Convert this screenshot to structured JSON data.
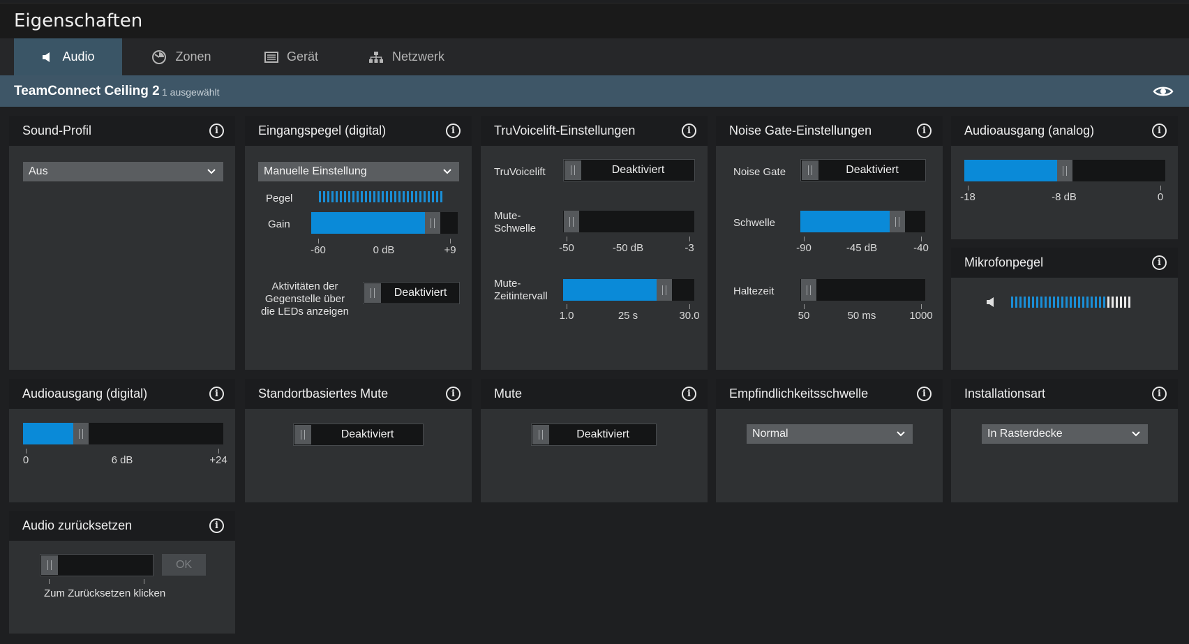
{
  "window": {
    "title": "Eigenschaften"
  },
  "tabs": [
    {
      "label": "Audio",
      "icon": "speaker-icon",
      "active": true
    },
    {
      "label": "Zonen",
      "icon": "zones-icon",
      "active": false
    },
    {
      "label": "Gerät",
      "icon": "device-icon",
      "active": false
    },
    {
      "label": "Netzwerk",
      "icon": "network-icon",
      "active": false
    }
  ],
  "device": {
    "name": "TeamConnect Ceiling 2",
    "selected": "1 ausgewählt"
  },
  "colors": {
    "accent": "#0a8ad8",
    "panel": "#2f3133",
    "header": "#1b1c1e",
    "tab_active": "#3a5566"
  },
  "sound_profile": {
    "title": "Sound-Profil",
    "value": "Aus"
  },
  "input_level": {
    "title": "Eingangspegel (digital)",
    "mode": "Manuelle Einstellung",
    "level_label": "Pegel",
    "gain_label": "Gain",
    "gain": {
      "min": "-60",
      "value": "0 dB",
      "max": "+9",
      "fraction": 0.87
    },
    "led_label": [
      "Aktivitäten der",
      "Gegenstelle über",
      "die LEDs anzeigen"
    ],
    "led_state": "Deaktiviert"
  },
  "truvoicelift": {
    "title": "TruVoicelift-Einstellungen",
    "enable_label": "TruVoicelift",
    "enable_state": "Deaktiviert",
    "threshold_label": [
      "Mute-",
      "Schwelle"
    ],
    "threshold": {
      "min": "-50",
      "value": "-50 dB",
      "max": "-3",
      "fraction": 0.0
    },
    "interval_label": [
      "Mute-",
      "Zeitintervall"
    ],
    "interval": {
      "min": "1.0",
      "value": "25 s",
      "max": "30.0",
      "fraction": 0.81
    }
  },
  "noise_gate": {
    "title": "Noise Gate-Einstellungen",
    "enable_label": "Noise Gate",
    "enable_state": "Deaktiviert",
    "threshold_label": "Schwelle",
    "threshold": {
      "min": "-90",
      "value": "-45 dB",
      "max": "-40",
      "fraction": 0.82
    },
    "hold_label": "Haltezeit",
    "hold": {
      "min": "50",
      "value": "50 ms",
      "max": "1000",
      "fraction": 0.0
    }
  },
  "analog_out": {
    "title": "Audioausgang (analog)",
    "level": {
      "min": "-18",
      "value": "-8 dB",
      "max": "0",
      "fraction": 0.5
    }
  },
  "mic_level": {
    "title": "Mikrofonpegel"
  },
  "digital_out": {
    "title": "Audioausgang (digital)",
    "level": {
      "min": "0",
      "value": "6 dB",
      "max": "+24",
      "fraction": 0.27
    }
  },
  "location_mute": {
    "title": "Standortbasiertes Mute",
    "state": "Deaktiviert"
  },
  "mute": {
    "title": "Mute",
    "state": "Deaktiviert"
  },
  "sensitivity": {
    "title": "Empfindlichkeitsschwelle",
    "value": "Normal"
  },
  "installation": {
    "title": "Installationsart",
    "value": "In Rasterdecke"
  },
  "reset": {
    "title": "Audio zurücksetzen",
    "ok_label": "OK",
    "hint": "Zum Zurücksetzen klicken"
  }
}
